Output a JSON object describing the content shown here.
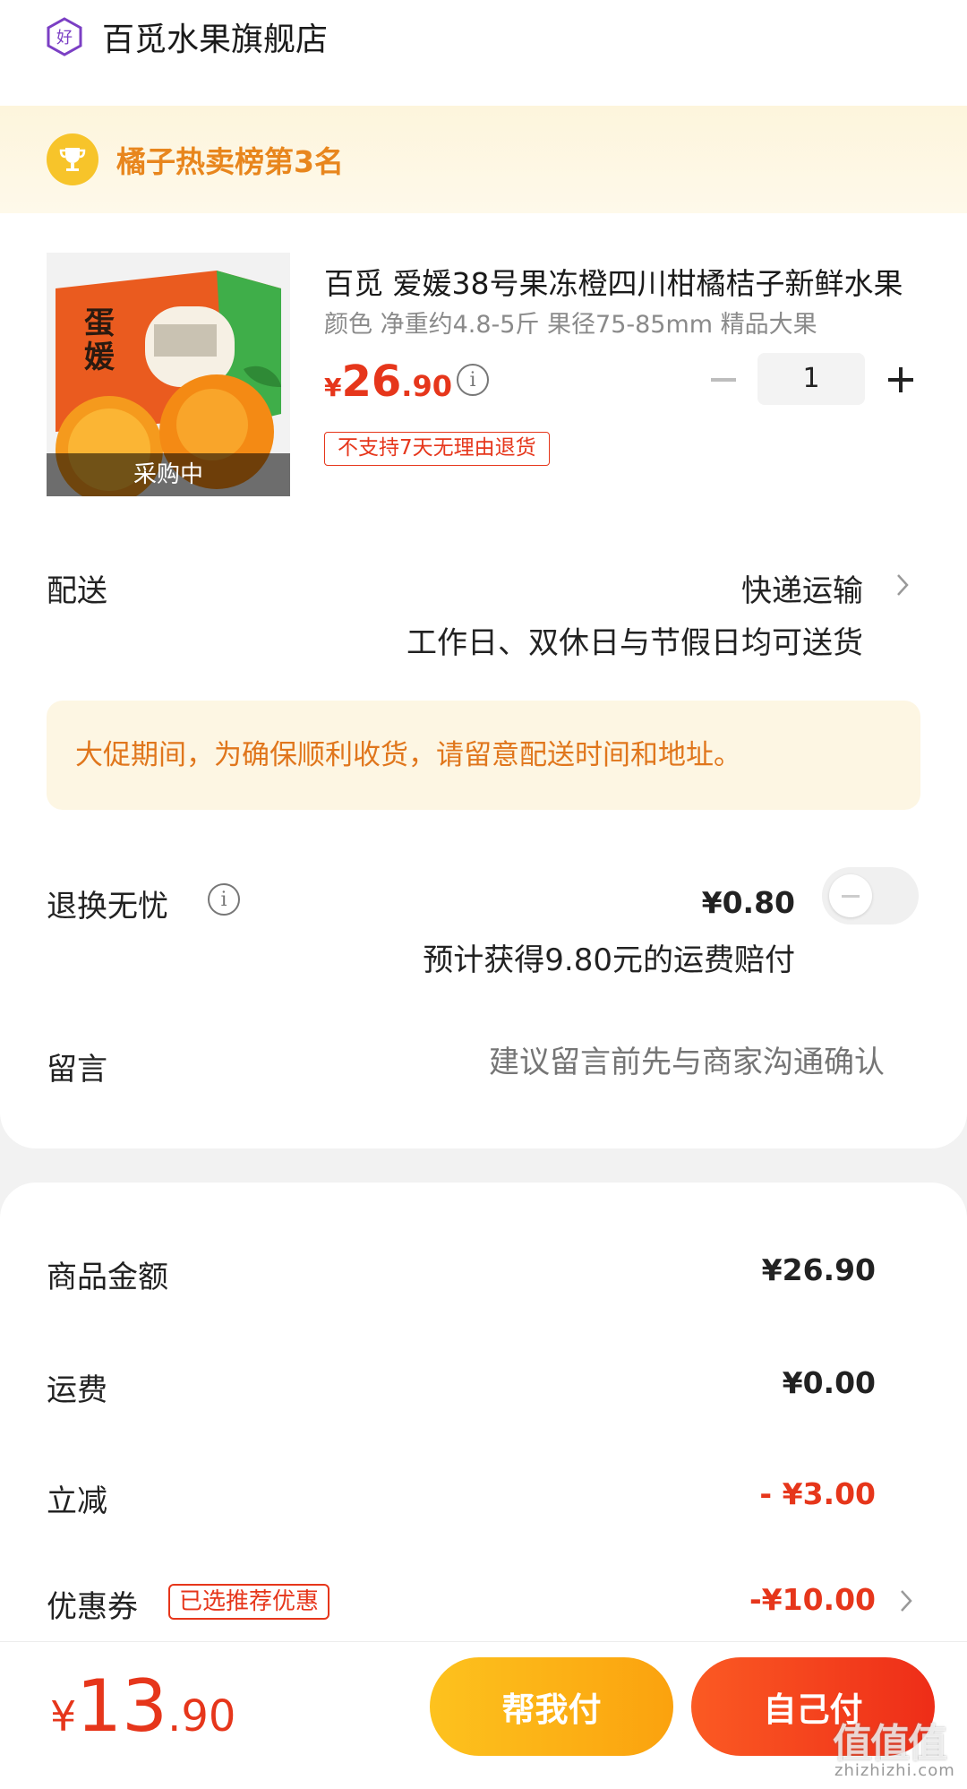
{
  "shop": {
    "badge_icon": "haodian-badge-icon",
    "name": "百觅水果旗舰店"
  },
  "ranking": {
    "icon": "trophy-icon",
    "text": "橘子热卖榜第3名"
  },
  "product": {
    "title": "百觅 爱媛38号果冻橙四川柑橘桔子新鲜水果",
    "spec": "颜色 净重约4.8-5斤 果径75-85mm 精品大果",
    "price_symbol": "¥",
    "price_int": "26",
    "price_dec": ".90",
    "thumbnail_status": "采购中",
    "quantity": "1",
    "return_policy_tag": "不支持7天无理由退货"
  },
  "shipping": {
    "label": "配送",
    "method": "快递运输",
    "note": "工作日、双休日与节假日均可送货"
  },
  "notice": "大促期间，为确保顺利收货，请留意配送时间和地址。",
  "return_insurance": {
    "label": "退换无忧",
    "price": "¥0.80",
    "enabled": false,
    "note": "预计获得9.80元的运费赔付"
  },
  "message": {
    "label": "留言",
    "placeholder": "建议留言前先与商家沟通确认"
  },
  "summary": {
    "goods_label": "商品金额",
    "goods_value": "¥26.90",
    "freight_label": "运费",
    "freight_value": "¥0.00",
    "discount_label": "立减",
    "discount_value": "- ¥3.00",
    "coupon_label": "优惠券",
    "coupon_tag": "已选推荐优惠",
    "coupon_value": "-¥10.00"
  },
  "bottom": {
    "total_symbol": "¥",
    "total_int": "13",
    "total_dec": ".90",
    "help_pay_label": "帮我付",
    "self_pay_label": "自己付"
  },
  "watermark": {
    "big": "值值值",
    "small": "zhizhizhi.com"
  },
  "colors": {
    "accent_red": "#e6361b",
    "accent_orange": "#e8861d",
    "help_button": "#fdb417"
  }
}
